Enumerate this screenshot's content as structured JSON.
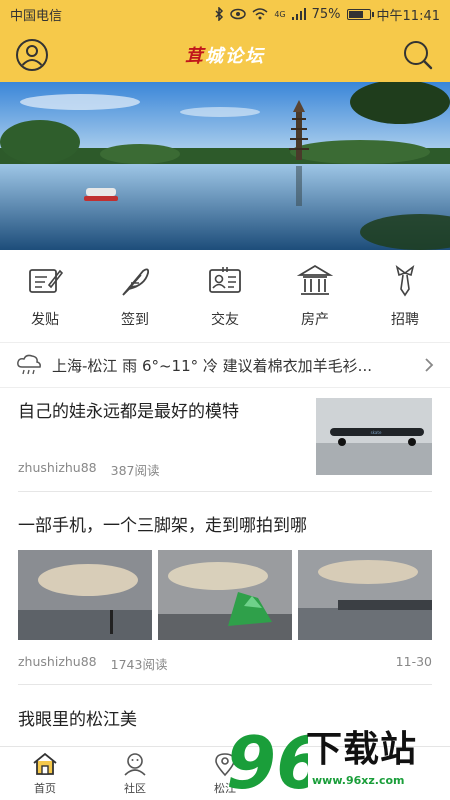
{
  "status": {
    "carrier": "中国电信",
    "battery": "75%",
    "battery_level": 0.75,
    "time": "中午11:41",
    "net": "4G"
  },
  "header": {
    "brand": "茸城论坛",
    "brand_first": "茸",
    "brand_rest": "城论坛"
  },
  "quick_nav": [
    {
      "label": "发贴",
      "icon": "compose-icon"
    },
    {
      "label": "签到",
      "icon": "feather-icon"
    },
    {
      "label": "交友",
      "icon": "contact-card-icon"
    },
    {
      "label": "房产",
      "icon": "building-icon"
    },
    {
      "label": "招聘",
      "icon": "tie-icon"
    }
  ],
  "weather": {
    "text": "上海-松江 雨 6°~11° 冷 建议着棉衣加羊毛衫..."
  },
  "posts": [
    {
      "title": "自己的娃永远都是最好的模特",
      "author": "zhushizhu88",
      "reads": "387阅读",
      "date": ""
    },
    {
      "title": "一部手机，一个三脚架，走到哪拍到哪",
      "author": "zhushizhu88",
      "reads": "1743阅读",
      "date": "11-30"
    },
    {
      "title": "我眼里的松江美",
      "author": "",
      "reads": "",
      "date": ""
    }
  ],
  "tabs": [
    {
      "label": "首页",
      "icon": "home-icon"
    },
    {
      "label": "社区",
      "icon": "community-icon"
    },
    {
      "label": "松江",
      "icon": "location-icon"
    }
  ],
  "watermark": {
    "number": "96",
    "text": "下载站",
    "url": "www.96xz.com"
  },
  "colors": {
    "accent": "#f6c94a",
    "brand_red": "#c0161c",
    "watermark_green": "#1a9e3a"
  }
}
